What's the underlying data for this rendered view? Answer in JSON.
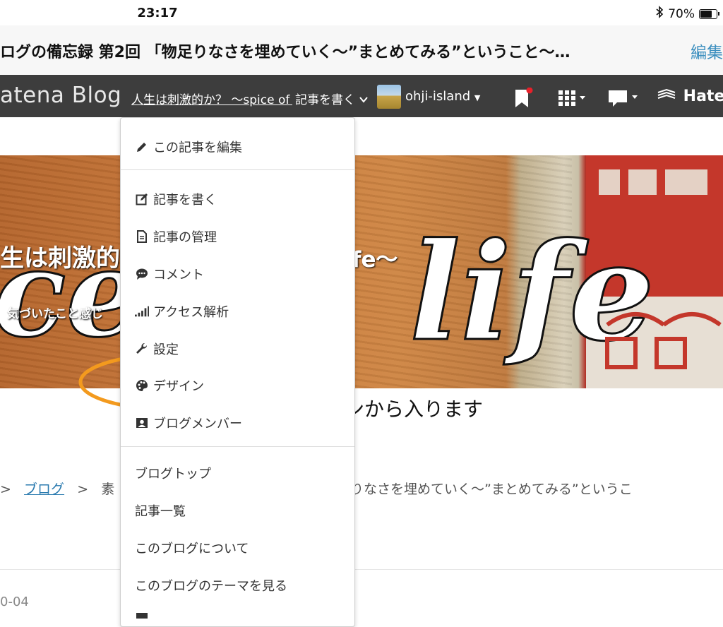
{
  "status_bar": {
    "time": "23:17",
    "battery": "70%",
    "bluetooth_icon": "bluetooth-icon",
    "battery_level": 0.7
  },
  "title_bar": {
    "title": "ログの備忘録 第2回 「物足りなさを埋めていく〜”まとめてみる”ということ〜…",
    "edit": "編集"
  },
  "header": {
    "logo": "atena Blog",
    "blog_link": "人生は刺激的か？ 〜spice of life〜",
    "write_overlap": "記事を書く",
    "user": "ohji-island",
    "hatena": "Hate",
    "icons": [
      "bookmark-icon",
      "grid-icon",
      "comment-icon"
    ],
    "notification_color": "#e8202a",
    "bar_color": "#3d3d3d"
  },
  "hero": {
    "title": "生は刺激的",
    "title_end": "fe〜",
    "desc": "気づいたこと感じ",
    "script_left": "ce",
    "script_right": "life"
  },
  "dropdown": {
    "items": [
      {
        "label": "この記事を編集",
        "icon": "pencil-icon"
      },
      {
        "label": "記事を書く",
        "icon": "edit-icon"
      },
      {
        "label": "記事の管理",
        "icon": "document-icon"
      },
      {
        "label": "コメント",
        "icon": "comment-icon"
      },
      {
        "label": "アクセス解析",
        "icon": "signal-icon"
      },
      {
        "label": "設定",
        "icon": "wrench-icon"
      },
      {
        "label": "デザイン",
        "icon": "palette-icon"
      },
      {
        "label": "ブログメンバー",
        "icon": "member-icon"
      },
      {
        "label": "ブログトップ"
      },
      {
        "label": "記事一覧"
      },
      {
        "label": "このブログについて"
      },
      {
        "label": "このブログのテーマを見る"
      }
    ]
  },
  "annotation": {
    "text": "デザインから入ります",
    "highlight_color": "#f39a1e"
  },
  "breadcrumb": {
    "sep": ">",
    "link": "ブログ",
    "current_start": "素",
    "current_rest": "りなさを埋めていく〜”まとめてみる”というこ"
  },
  "post": {
    "date": "0-04"
  }
}
